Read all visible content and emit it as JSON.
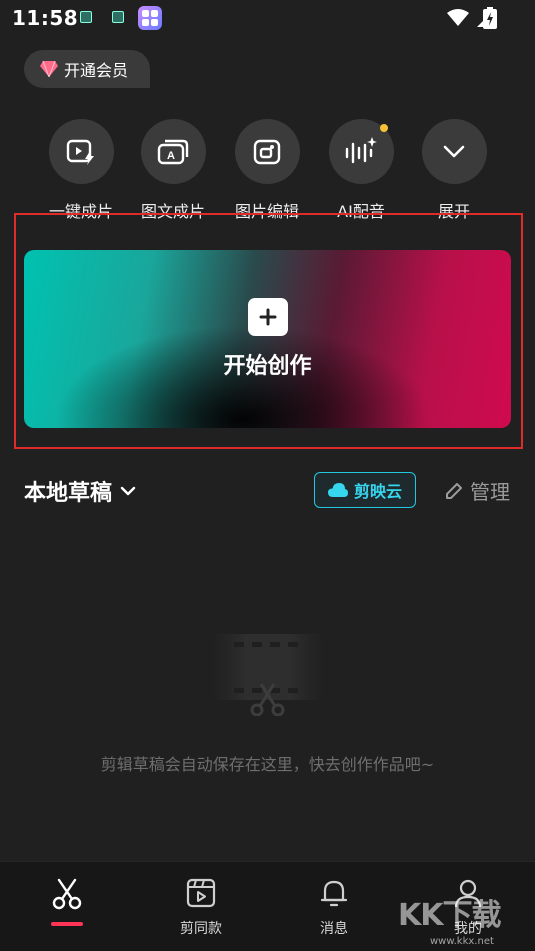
{
  "status_bar": {
    "time": "11:58"
  },
  "member": {
    "label": "开通会员"
  },
  "tools": [
    {
      "label": "一键成片",
      "icon": "auto-video-icon"
    },
    {
      "label": "图文成片",
      "icon": "text-to-video-icon"
    },
    {
      "label": "图片编辑",
      "icon": "image-edit-icon"
    },
    {
      "label": "AI配音",
      "icon": "ai-voice-icon"
    },
    {
      "label": "展开",
      "icon": "chevron-down-icon"
    }
  ],
  "create": {
    "label": "开始创作"
  },
  "drafts": {
    "title": "本地草稿",
    "cloud_label": "剪映云",
    "manage_label": "管理",
    "empty_text": "剪辑草稿会自动保存在这里，快去创作作品吧~"
  },
  "nav": [
    {
      "label": "",
      "icon": "scissors-icon",
      "active": true
    },
    {
      "label": "剪同款",
      "icon": "template-icon"
    },
    {
      "label": "消息",
      "icon": "bell-icon"
    },
    {
      "label": "我的",
      "icon": "profile-icon"
    }
  ],
  "watermark": {
    "text": "KK下载",
    "url": "www.kkx.net"
  },
  "colors": {
    "accent_cyan": "#22c8e0",
    "nav_active": "#ff3355",
    "highlight": "#e02b2b"
  }
}
